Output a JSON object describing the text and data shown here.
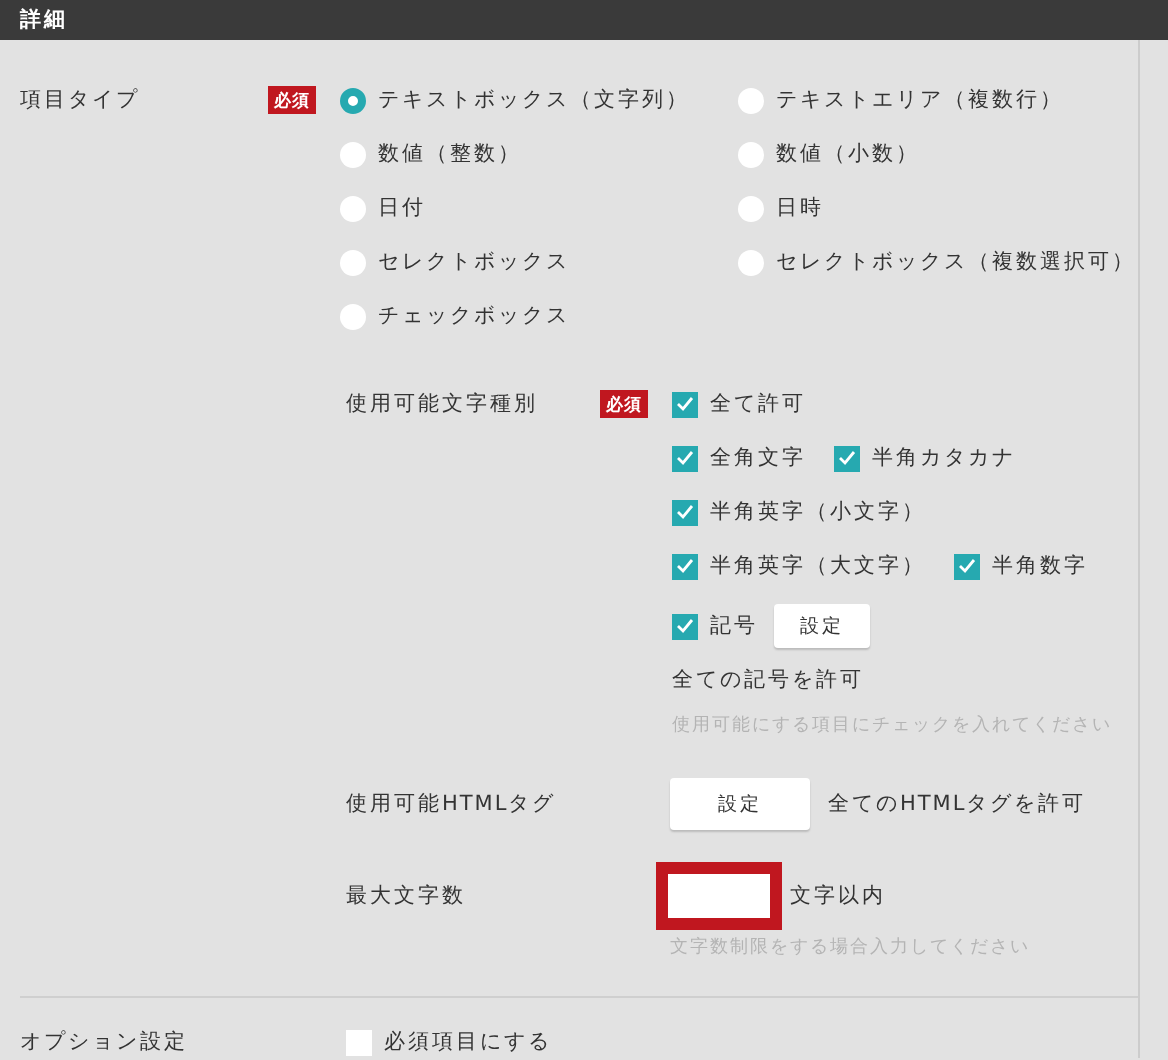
{
  "header": {
    "title": "詳細"
  },
  "item_type": {
    "label": "項目タイプ",
    "badge": "必須",
    "options": [
      {
        "label": "テキストボックス（文字列）",
        "selected": true
      },
      {
        "label": "テキストエリア（複数行）",
        "selected": false
      },
      {
        "label": "数値（整数）",
        "selected": false
      },
      {
        "label": "数値（小数）",
        "selected": false
      },
      {
        "label": "日付",
        "selected": false
      },
      {
        "label": "日時",
        "selected": false
      },
      {
        "label": "セレクトボックス",
        "selected": false
      },
      {
        "label": "セレクトボックス（複数選択可）",
        "selected": false
      },
      {
        "label": "チェックボックス",
        "selected": false
      }
    ]
  },
  "char_types": {
    "label": "使用可能文字種別",
    "badge": "必須",
    "rows": [
      [
        {
          "label": "全て許可",
          "checked": true
        }
      ],
      [
        {
          "label": "全角文字",
          "checked": true
        },
        {
          "label": "半角カタカナ",
          "checked": true
        }
      ],
      [
        {
          "label": "半角英字（小文字）",
          "checked": true
        }
      ],
      [
        {
          "label": "半角英字（大文字）",
          "checked": true
        },
        {
          "label": "半角数字",
          "checked": true
        }
      ],
      [
        {
          "label": "記号",
          "checked": true
        }
      ]
    ],
    "symbol_button": "設定",
    "symbol_note": "全ての記号を許可",
    "hint": "使用可能にする項目にチェックを入れてください"
  },
  "html_tags": {
    "label": "使用可能HTMLタグ",
    "button": "設定",
    "note": "全てのHTMLタグを許可"
  },
  "max_length": {
    "label": "最大文字数",
    "highlighted": true,
    "suffix": "文字以内",
    "hint": "文字数制限をする場合入力してください"
  },
  "options": {
    "label": "オプション設定",
    "checkbox": {
      "label": "必須項目にする",
      "checked": false
    }
  }
}
